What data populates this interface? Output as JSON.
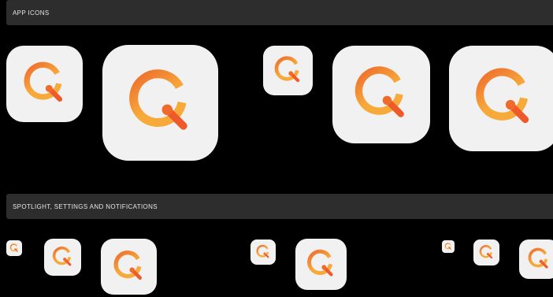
{
  "sections": {
    "app_icons": {
      "title": "APP ICONS"
    },
    "spotlight": {
      "title": "SPOTLIGHT, SETTINGS AND NOTIFICATIONS"
    }
  },
  "icon": {
    "name": "q-app-icon",
    "background": "#f1f1f1",
    "ring_colors": [
      "#ee6b2d",
      "#f7a93a"
    ],
    "handle_color": "#ee5a2a",
    "knob_color": "#f06a2b"
  },
  "colors": {
    "page_background": "#000000",
    "section_bar": "#2d2d2d",
    "section_text": "#e6e6e6"
  }
}
